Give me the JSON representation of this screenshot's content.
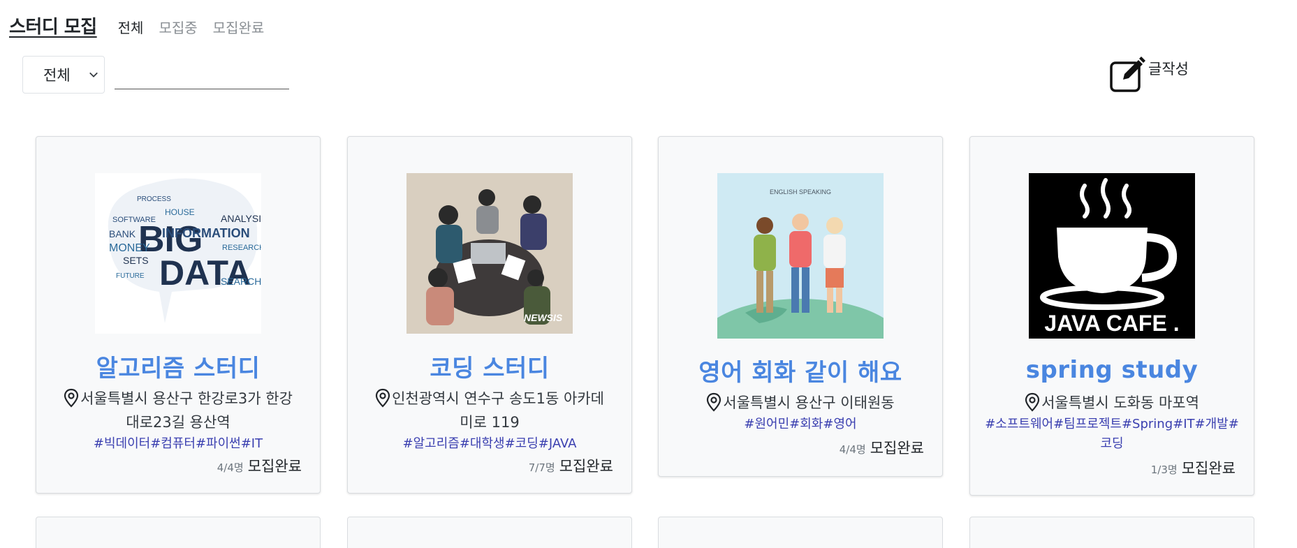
{
  "header": {
    "brand": "스터디 모집",
    "tabs": [
      {
        "label": "전체",
        "active": true
      },
      {
        "label": "모집중",
        "active": false
      },
      {
        "label": "모집완료",
        "active": false
      }
    ]
  },
  "toolbar": {
    "filter_selected": "전체",
    "search_value": "",
    "write_label": "글작성"
  },
  "cards": [
    {
      "title": "알고리즘 스터디",
      "location": "서울특별시 용산구 한강로3가 한강대로23길 용산역",
      "tags": "#빅데이터#컴퓨터#파이썬#IT",
      "count": "4/4명",
      "status": "모집완료",
      "image": "big-data-word-cloud"
    },
    {
      "title": "코딩 스터디",
      "location": "인천광역시 연수구 송도1동 아카데미로 119",
      "tags": "#알고리즘#대학생#코딩#JAVA",
      "count": "7/7명",
      "status": "모집완료",
      "image": "team-meeting-illustration",
      "image_caption": "NEWSIS"
    },
    {
      "title": "영어 회화 같이 해요",
      "location": "서울특별시 용산구 이태원동",
      "tags": "#원어민#회화#영어",
      "count": "4/4명",
      "status": "모집완료",
      "image": "english-speaking-illustration",
      "image_caption": "ENGLISH SPEAKING"
    },
    {
      "title": "spring study",
      "location": "서울특별시 도화동 마포역",
      "tags": "#소프트웨어#팀프로젝트#Spring#IT#개발#코딩",
      "count": "1/3명",
      "status": "모집완료",
      "image": "java-cafe-logo",
      "image_caption": "JAVA CAFE ."
    }
  ],
  "colors": {
    "title": "#4a86e0",
    "tags": "#3a3fb0",
    "card_bg": "#f8f9fa"
  }
}
